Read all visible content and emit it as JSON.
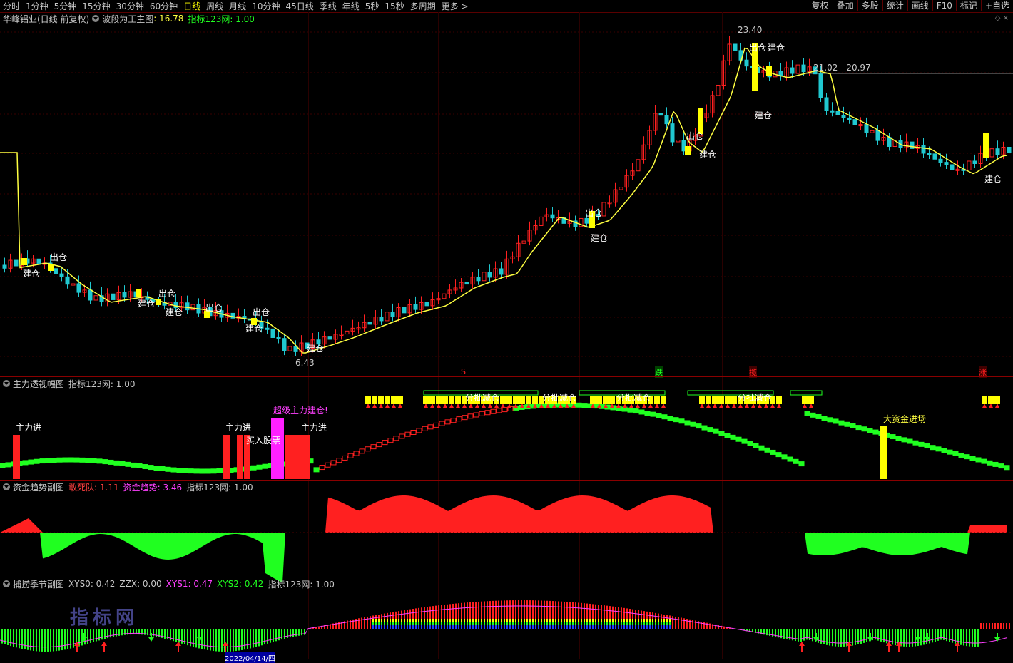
{
  "toolbar": {
    "periods": [
      "分时",
      "1分钟",
      "5分钟",
      "15分钟",
      "30分钟",
      "60分钟",
      "日线",
      "周线",
      "月线",
      "10分钟",
      "45日线",
      "季线",
      "年线",
      "5秒",
      "15秒",
      "多周期",
      "更多 >"
    ],
    "active_index": 6,
    "right_buttons": [
      "复权",
      "叠加",
      "多股",
      "统计",
      "画线",
      "F10",
      "标记",
      "+自选"
    ]
  },
  "main_panel": {
    "title": "华峰铝业(日线 前复权)",
    "indicator_name": "波段为王主图",
    "indicator_value": ": 16.78",
    "net_label": "指标123网: 1.00",
    "high_label": "23.40",
    "low_label": "6.43",
    "range_label": "21.02 - 20.97",
    "signal_labels": [
      "建仓",
      "出仓",
      "建仓",
      "出仓",
      "建仓",
      "出仓",
      "建仓",
      "出仓",
      "建仓",
      "建仓",
      "出仓",
      "建仓",
      "出仓",
      "建仓",
      "出仓",
      "建仓",
      "建仓"
    ],
    "bottom_markers": [
      "S",
      "跌",
      "揽",
      "涨"
    ]
  },
  "panel2": {
    "title": "主力透视幅图",
    "net_label": "指标123网: 1.00",
    "labels": [
      "主力进",
      "主力进",
      "买入股票",
      "超级主力建仓!",
      "主力进",
      "分批减仓",
      "分批减仓",
      "分批减仓",
      "分批减仓",
      "大资金进场"
    ]
  },
  "panel3": {
    "title": "资金趋势副图",
    "v1_label": "敢死队: 1.11",
    "v2_label": "资金趋势: 3.46",
    "net_label": "指标123网: 1.00"
  },
  "panel4": {
    "title": "捕捞季节副图",
    "v1_label": "XYS0: 0.42",
    "v2_label": "ZZX: 0.00",
    "v3_label": "XYS1: 0.47",
    "v4_label": "XYS2: 0.42",
    "net_label": "指标123网: 1.00",
    "watermark": "指标网",
    "date_label": "2022/04/14/四"
  },
  "colors": {
    "up": "#ff2020",
    "down": "#20c8d0",
    "ma": "#ffff40",
    "signal": "#ffff00",
    "green": "#20ff20",
    "magenta": "#ff20ff"
  }
}
